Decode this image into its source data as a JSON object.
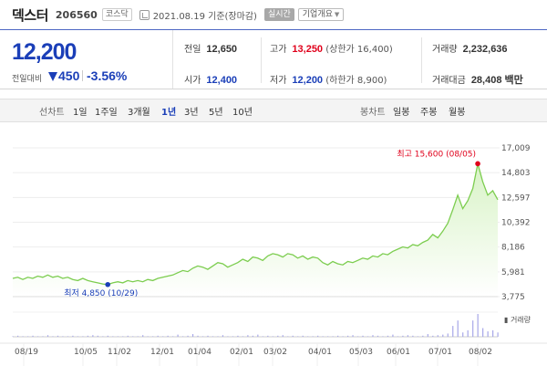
{
  "stock": {
    "name": "덱스터",
    "code": "206560",
    "market": "코스닥",
    "date_text": "2021.08.19 기준(장마감)",
    "realtime_label": "실시간",
    "company_info_label": "기업개요"
  },
  "price": {
    "current": "12,200",
    "change_label": "전일대비",
    "change_value": "450",
    "change_rate": "-3.56%",
    "direction": "down"
  },
  "stats": {
    "prev_close": {
      "label": "전일",
      "value": "12,650"
    },
    "open": {
      "label": "시가",
      "value": "12,400"
    },
    "high": {
      "label": "고가",
      "value": "13,250",
      "sub": "(상한가 16,400)"
    },
    "low": {
      "label": "저가",
      "value": "12,200",
      "sub": "(하한가 8,900)"
    },
    "volume": {
      "label": "거래량",
      "value": "2,232,636"
    },
    "trade_value": {
      "label": "거래대금",
      "value": "28,408 백만"
    }
  },
  "colors": {
    "price_down": "#1b3fb8",
    "price_up": "#e0001b",
    "chart_line": "#7ccd4f",
    "chart_fill": "#d8f3c6",
    "volume_bar": "#a7a7e8"
  },
  "tabs": {
    "line_label": "선차트",
    "line_periods": [
      "1일",
      "1주일",
      "3개월",
      "1년",
      "3년",
      "5년",
      "10년"
    ],
    "active_period": "1년",
    "candle_label": "봉차트",
    "candle_periods": [
      "일봉",
      "주봉",
      "월봉"
    ]
  },
  "chart_data": {
    "type": "area",
    "y_ticks": [
      "17,009",
      "14,803",
      "12,597",
      "10,392",
      "8,186",
      "5,981",
      "3,775"
    ],
    "ylim": [
      3775,
      17009
    ],
    "x_ticks": [
      "08/19",
      "10/05",
      "11/02",
      "12/01",
      "01/04",
      "02/01",
      "03/02",
      "04/01",
      "05/03",
      "06/01",
      "07/01",
      "08/02"
    ],
    "high_annotation": "최고 15,600 (08/05)",
    "low_annotation": "최저 4,850 (10/29)",
    "volume_label": "거래량",
    "series": [
      {
        "values": [
          5400,
          5500,
          5300,
          5500,
          5400,
          5600,
          5500,
          5700,
          5500,
          5600,
          5400,
          5500,
          5300,
          5200,
          5400,
          5200,
          5100,
          5000,
          4900,
          4850,
          5000,
          5100,
          5000,
          5200,
          5100,
          5200,
          5100,
          5300,
          5200,
          5400,
          5500,
          5600,
          5700,
          5900,
          6100,
          6000,
          6300,
          6500,
          6400,
          6200,
          6500,
          6800,
          6700,
          6400,
          6600,
          6800,
          7100,
          6900,
          7300,
          7200,
          7000,
          7400,
          7600,
          7500,
          7300,
          7600,
          7500,
          7200,
          7400,
          7100,
          7300,
          7200,
          6800,
          6600,
          6900,
          6700,
          6600,
          6900,
          6800,
          7000,
          7200,
          7100,
          7400,
          7300,
          7600,
          7500,
          7800,
          8000,
          8200,
          8100,
          8400,
          8300,
          8600,
          8800,
          9300,
          9000,
          9600,
          10300,
          11500,
          12800,
          11600,
          12300,
          13400,
          15600,
          14000,
          12800,
          13200,
          12400
        ]
      }
    ],
    "volume": [
      1,
      2,
      1,
      1,
      2,
      1,
      1,
      3,
      1,
      2,
      1,
      1,
      2,
      1,
      1,
      2,
      3,
      2,
      1,
      2,
      1,
      1,
      1,
      2,
      1,
      1,
      3,
      1,
      1,
      2,
      1,
      2,
      1,
      4,
      1,
      2,
      5,
      2,
      1,
      2,
      1,
      1,
      3,
      1,
      1,
      2,
      1,
      3,
      2,
      4,
      1,
      2,
      1,
      2,
      3,
      1,
      2,
      1,
      2,
      1,
      1,
      2,
      1,
      1,
      1,
      2,
      1,
      2,
      3,
      1,
      2,
      1,
      3,
      2,
      1,
      2,
      4,
      1,
      2,
      3,
      2,
      1,
      2,
      5,
      2,
      3,
      4,
      6,
      20,
      30,
      8,
      12,
      30,
      42,
      16,
      10,
      12,
      8
    ],
    "grid": true
  }
}
